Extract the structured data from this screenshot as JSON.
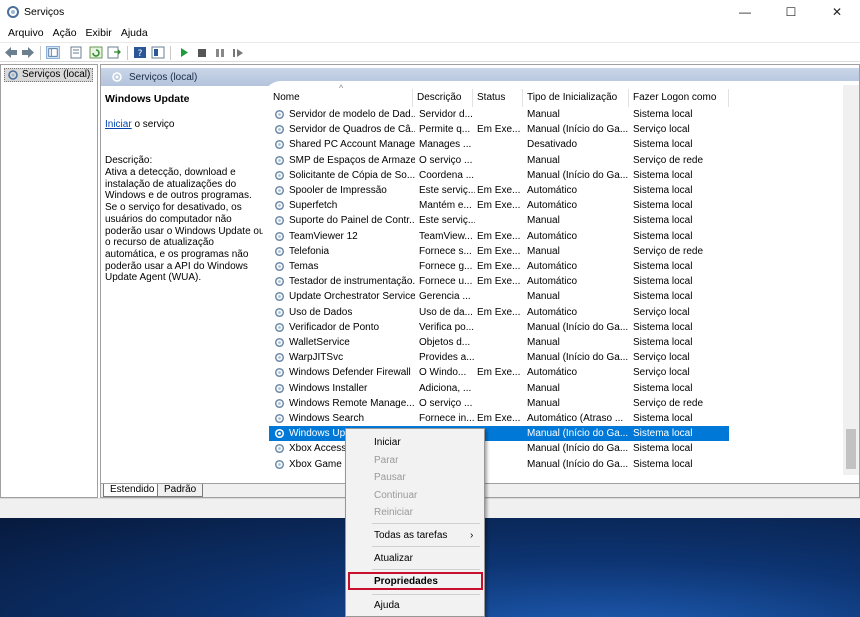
{
  "window": {
    "title": "Serviços",
    "minimize_glyph": "—",
    "maximize_glyph": "☐",
    "close_glyph": "✕"
  },
  "menu": [
    "Arquivo",
    "Ação",
    "Exibir",
    "Ajuda"
  ],
  "toolbar_icons": [
    "back-arrow-icon",
    "forward-arrow-icon",
    "console-tree-icon",
    "properties-icon",
    "refresh-icon",
    "export-list-icon",
    "help-icon",
    "show-pane-icon",
    "start-service-icon",
    "stop-service-icon",
    "pause-service-icon",
    "restart-service-icon"
  ],
  "tree": {
    "item": "Serviços (local)"
  },
  "main_header": {
    "title": "Serviços (local)"
  },
  "description": {
    "title": "Windows Update",
    "action_link": "Iniciar",
    "action_suffix": " o serviço",
    "label": "Descrição:",
    "text": "Ativa a detecção, download e instalação de atualizações do Windows e de outros programas. Se o serviço for desativado, os usuários do computador não poderão usar o Windows Update ou o recurso de atualização automática, e os programas não poderão usar a API do Windows Update Agent (WUA)."
  },
  "columns": [
    "Nome",
    "Descrição",
    "Status",
    "Tipo de Inicialização",
    "Fazer Logon como"
  ],
  "rows": [
    {
      "name": "Servidor de modelo de Dad...",
      "desc": "Servidor d...",
      "status": "",
      "startup": "Manual",
      "logon": "Sistema local"
    },
    {
      "name": "Servidor de Quadros de Câ...",
      "desc": "Permite q...",
      "status": "Em Exe...",
      "startup": "Manual (Início do Ga...",
      "logon": "Serviço local"
    },
    {
      "name": "Shared PC Account Manager",
      "desc": "Manages ...",
      "status": "",
      "startup": "Desativado",
      "logon": "Sistema local"
    },
    {
      "name": "SMP de Espaços de Armaze...",
      "desc": "O serviço ...",
      "status": "",
      "startup": "Manual",
      "logon": "Serviço de rede"
    },
    {
      "name": "Solicitante de Cópia de So...",
      "desc": "Coordena ...",
      "status": "",
      "startup": "Manual (Início do Ga...",
      "logon": "Sistema local"
    },
    {
      "name": "Spooler de Impressão",
      "desc": "Este serviç...",
      "status": "Em Exe...",
      "startup": "Automático",
      "logon": "Sistema local"
    },
    {
      "name": "Superfetch",
      "desc": "Mantém e...",
      "status": "Em Exe...",
      "startup": "Automático",
      "logon": "Sistema local"
    },
    {
      "name": "Suporte do Painel de Contr...",
      "desc": "Este serviç...",
      "status": "",
      "startup": "Manual",
      "logon": "Sistema local"
    },
    {
      "name": "TeamViewer 12",
      "desc": "TeamView...",
      "status": "Em Exe...",
      "startup": "Automático",
      "logon": "Sistema local"
    },
    {
      "name": "Telefonia",
      "desc": "Fornece s...",
      "status": "Em Exe...",
      "startup": "Manual",
      "logon": "Serviço de rede"
    },
    {
      "name": "Temas",
      "desc": "Fornece g...",
      "status": "Em Exe...",
      "startup": "Automático",
      "logon": "Sistema local"
    },
    {
      "name": "Testador de instrumentação...",
      "desc": "Fornece u...",
      "status": "Em Exe...",
      "startup": "Automático",
      "logon": "Sistema local"
    },
    {
      "name": "Update Orchestrator Service",
      "desc": "Gerencia ...",
      "status": "",
      "startup": "Manual",
      "logon": "Sistema local"
    },
    {
      "name": "Uso de Dados",
      "desc": "Uso de da...",
      "status": "Em Exe...",
      "startup": "Automático",
      "logon": "Serviço local"
    },
    {
      "name": "Verificador de Ponto",
      "desc": "Verifica po...",
      "status": "",
      "startup": "Manual (Início do Ga...",
      "logon": "Sistema local"
    },
    {
      "name": "WalletService",
      "desc": "Objetos d...",
      "status": "",
      "startup": "Manual",
      "logon": "Sistema local"
    },
    {
      "name": "WarpJITSvc",
      "desc": "Provides a...",
      "status": "",
      "startup": "Manual (Início do Ga...",
      "logon": "Serviço local"
    },
    {
      "name": "Windows Defender Firewall",
      "desc": "O Windo...",
      "status": "Em Exe...",
      "startup": "Automático",
      "logon": "Serviço local"
    },
    {
      "name": "Windows Installer",
      "desc": "Adiciona, ...",
      "status": "",
      "startup": "Manual",
      "logon": "Sistema local"
    },
    {
      "name": "Windows Remote Manage...",
      "desc": "O serviço ...",
      "status": "",
      "startup": "Manual",
      "logon": "Serviço de rede"
    },
    {
      "name": "Windows Search",
      "desc": "Fornece in...",
      "status": "Em Exe...",
      "startup": "Automático (Atraso ...",
      "logon": "Sistema local"
    },
    {
      "name": "Windows Update",
      "desc": "Ativa a ...",
      "status": "",
      "startup": "Manual (Início do Ga...",
      "logon": "Sistema local",
      "selected": true
    },
    {
      "name": "Xbox Accessory Managem...",
      "desc": "",
      "status": "",
      "startup": "Manual (Início do Ga...",
      "logon": "Sistema local"
    },
    {
      "name": "Xbox Game Monitoring",
      "desc": "",
      "status": "",
      "startup": "Manual (Início do Ga...",
      "logon": "Sistema local"
    }
  ],
  "tabs": [
    "Estendido",
    "Padrão"
  ],
  "context_menu": {
    "start": "Iniciar",
    "stop": "Parar",
    "pause": "Pausar",
    "resume": "Continuar",
    "restart": "Reiniciar",
    "all_tasks": "Todas as tarefas",
    "all_tasks_arrow": "›",
    "refresh": "Atualizar",
    "properties": "Propriedades",
    "help": "Ajuda"
  },
  "colors": {
    "selection": "#0078d7",
    "highlight_box": "#c8102e",
    "link": "#0645ad"
  }
}
